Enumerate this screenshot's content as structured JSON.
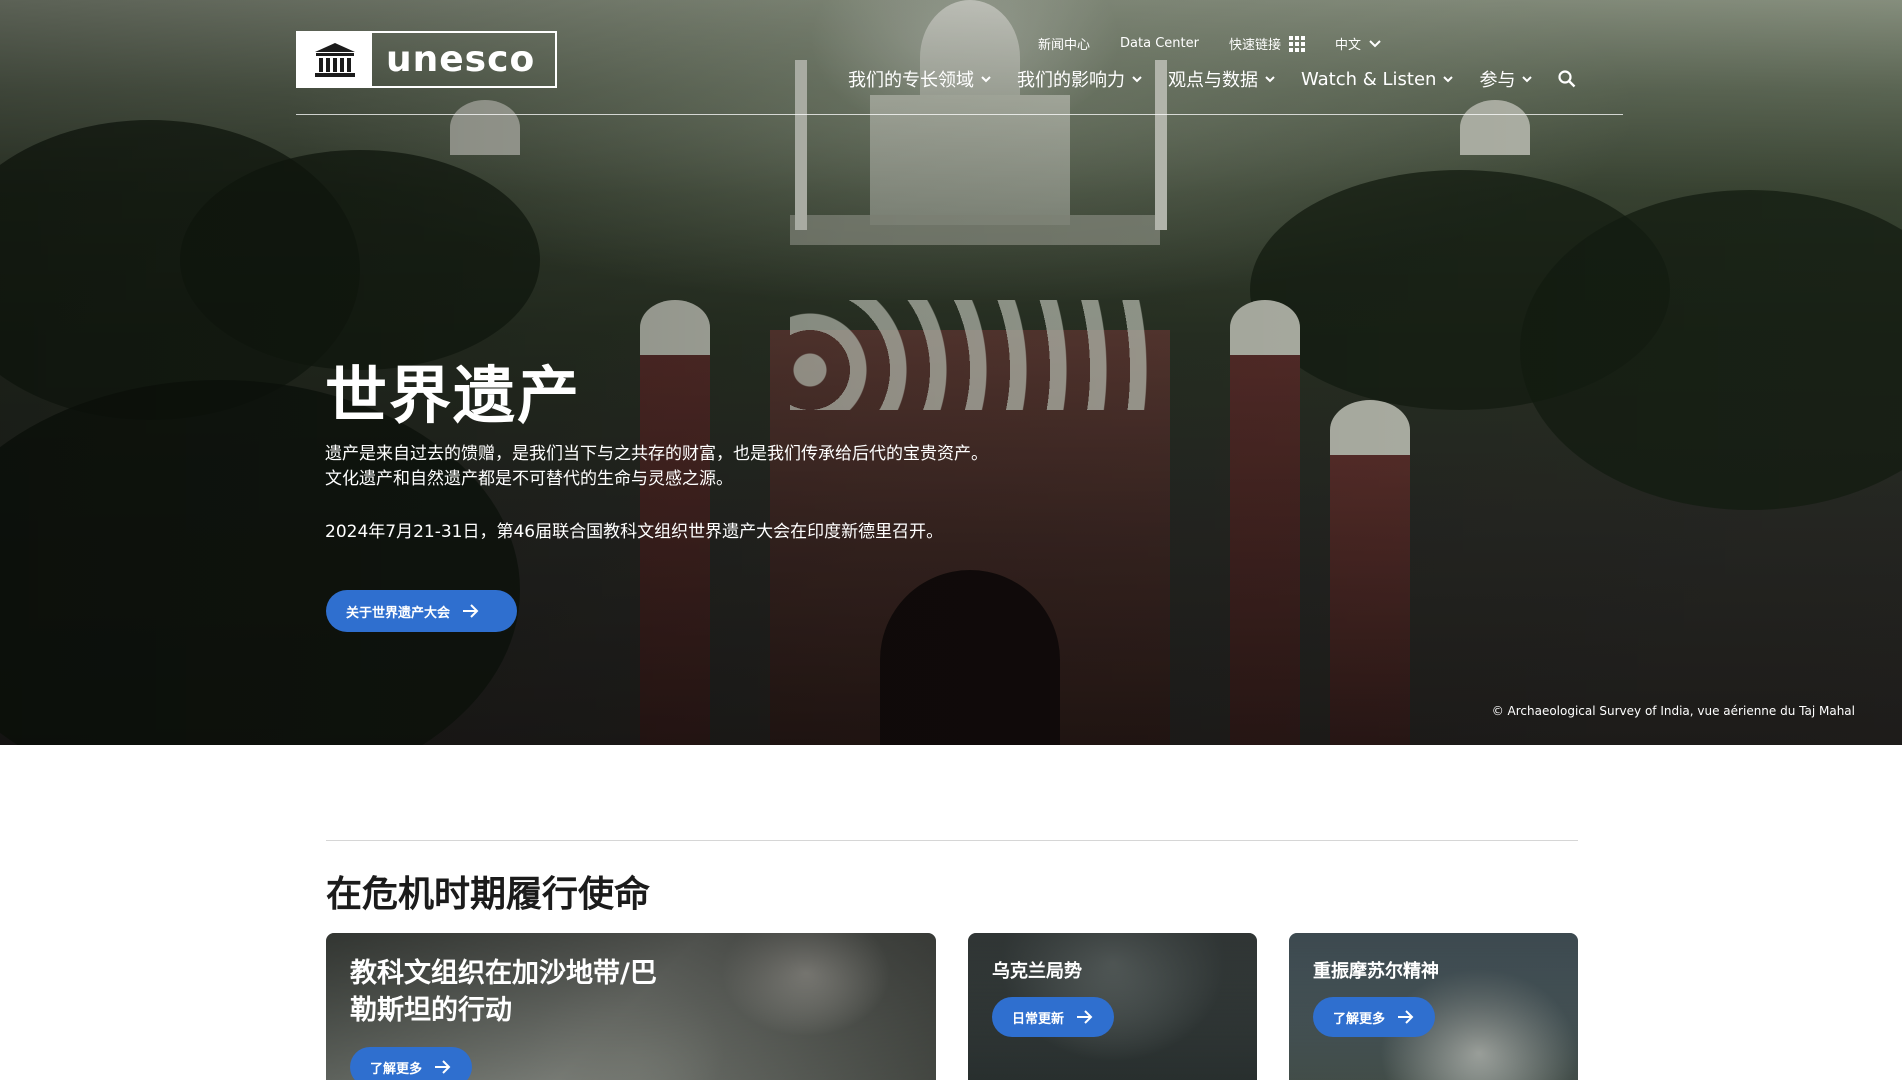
{
  "header": {
    "logo_text": "unesco",
    "top_links": [
      {
        "label": "新闻中心"
      },
      {
        "label": "Data Center"
      },
      {
        "label": "快速链接"
      },
      {
        "label": "中文"
      }
    ],
    "nav": [
      {
        "label": "我们的专长领域"
      },
      {
        "label": "我们的影响力"
      },
      {
        "label": "观点与数据"
      },
      {
        "label": "Watch & Listen"
      },
      {
        "label": "参与"
      }
    ]
  },
  "hero": {
    "title": "世界遗产",
    "desc_line1": "遗产是来自过去的馈赠，是我们当下与之共存的财富，也是我们传承给后代的宝贵资产。",
    "desc_line2": "文化遗产和自然遗产都是不可替代的生命与灵感之源。",
    "date_text": "2024年7月21-31日，第46届联合国教科文组织世界遗产大会在印度新德里召开。",
    "button_label": "关于世界遗产大会",
    "credit": "© Archaeological Survey of India, vue aérienne du Taj Mahal"
  },
  "section": {
    "title": "在危机时期履行使命",
    "cards": [
      {
        "title_line1": "教科文组织在加沙地带/巴",
        "title_line2": "勒斯坦的行动",
        "button_label": "了解更多"
      },
      {
        "title": "乌克兰局势",
        "button_label": "日常更新"
      },
      {
        "title": "重振摩苏尔精神",
        "button_label": "了解更多"
      }
    ]
  },
  "colors": {
    "accent_button": "#2f6fcf",
    "text_dark": "#1b1b1b"
  }
}
